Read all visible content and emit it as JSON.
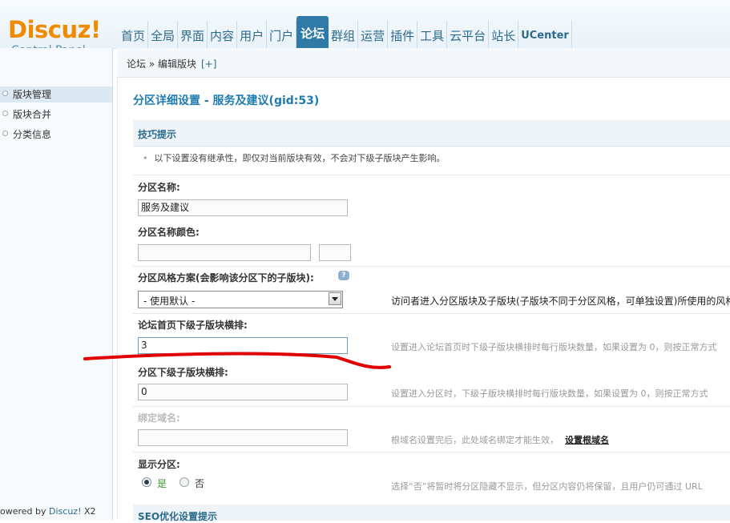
{
  "brand": {
    "logo": "Discuz!",
    "subtitle": "Control Panel"
  },
  "nav": {
    "items": [
      {
        "label": "首页"
      },
      {
        "label": "全局"
      },
      {
        "label": "界面"
      },
      {
        "label": "内容"
      },
      {
        "label": "用户"
      },
      {
        "label": "门户"
      },
      {
        "label": "论坛",
        "active": true
      },
      {
        "label": "群组"
      },
      {
        "label": "运营"
      },
      {
        "label": "插件"
      },
      {
        "label": "工具"
      },
      {
        "label": "云平台"
      },
      {
        "label": "站长"
      },
      {
        "label": "UCenter"
      }
    ]
  },
  "breadcrumb": {
    "path": "论坛 » 编辑版块",
    "add": "[+]"
  },
  "sidebar": {
    "items": [
      {
        "label": "版块管理",
        "active": true
      },
      {
        "label": "版块合并"
      },
      {
        "label": "分类信息"
      }
    ],
    "powered": "owered by",
    "powered_brand": "Discuz!",
    "powered_ver": " X2"
  },
  "main": {
    "title": "分区详细设置 - 服务及建议(gid:53)",
    "tips_title": "技巧提示",
    "tip": "以下设置没有继承性，即仅对当前版块有效，不会对下级子版块产生影响。",
    "fields": {
      "name_label": "分区名称:",
      "name_value": "服务及建议",
      "color_label": "分区名称颜色:",
      "style_label": "分区风格方案(会影响该分区下的子版块):",
      "style_value": "- 使用默认 -",
      "style_hint": "访问者进入分区版块及子版块(子版块不同于分区风格，可单独设置)所使用的风格",
      "forum_cols_label": "论坛首页下级子版块横排:",
      "forum_cols_value": "3",
      "forum_cols_hint": "设置进入论坛首页时下级子版块横排时每行版块数量，如果设置为 0，则按正常方式",
      "cat_cols_label": "分区下级子版块横排:",
      "cat_cols_value": "0",
      "cat_cols_hint": "设置进入分区时，下级子版块横排时每行版块数量，如果设置为 0，则按正常方式",
      "domain_label": "绑定域名:",
      "domain_hint": "根域名设置完后，此处域名绑定才能生效，",
      "domain_link": "设置根域名",
      "show_label": "显示分区:",
      "show_yes": "是",
      "show_no": "否",
      "show_hint": "选择“否”将暂时将分区隐藏不显示，但分区内容仍将保留，且用户仍可通过 URL"
    },
    "seo_title": "SEO优化设置提示"
  },
  "colors": {
    "accent": "#2f7aa7",
    "logo": "#f08a00",
    "title": "#1e7bb0",
    "annotation": "#e00000"
  },
  "icons": {
    "help": "question-bubble-icon",
    "bullet": "bullet-icon"
  }
}
